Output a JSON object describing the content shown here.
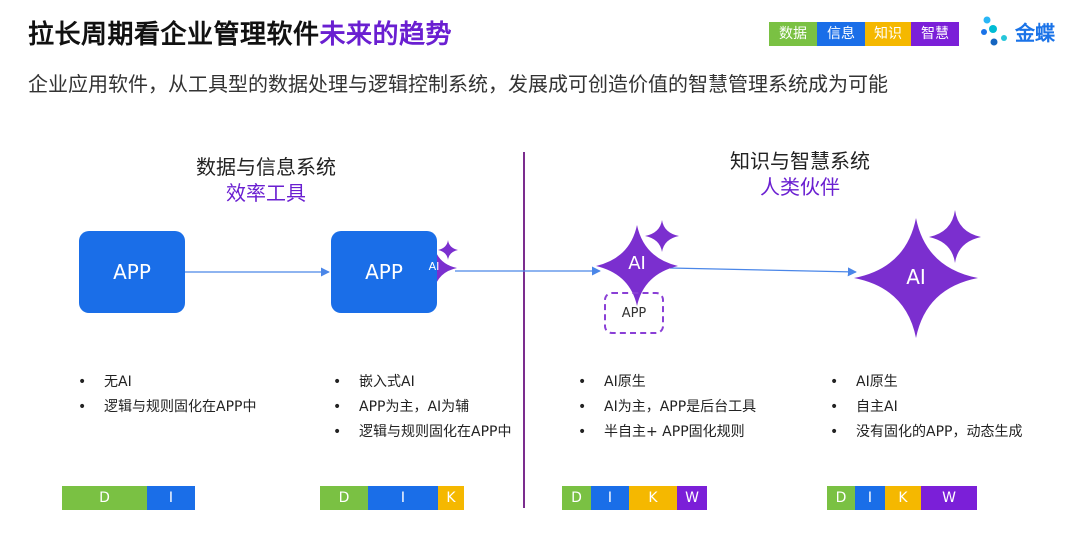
{
  "header": {
    "title_main": "拉长周期看企业管理软件",
    "title_highlight": "未来的趋势",
    "subtitle": "企业应用软件，从工具型的数据处理与逻辑控制系统，发展成可创造价值的智慧管理系统成为可能"
  },
  "legend": [
    {
      "label": "数据",
      "color": "#7ac143"
    },
    {
      "label": "信息",
      "color": "#1a6ee8"
    },
    {
      "label": "知识",
      "color": "#f5b800"
    },
    {
      "label": "智慧",
      "color": "#7b1fd8"
    }
  ],
  "logo": {
    "text": "金蝶"
  },
  "sections": {
    "left": {
      "heading": "数据与信息系统",
      "subheading": "效率工具"
    },
    "right": {
      "heading": "知识与智慧系统",
      "subheading": "人类伙伴"
    }
  },
  "stages": [
    {
      "node_label": "APP",
      "bullets": [
        "无AI",
        "逻辑与规则固化在APP中"
      ],
      "dikw": [
        "D",
        "I"
      ]
    },
    {
      "node_label": "APP",
      "badge_label": "AI",
      "bullets": [
        "嵌入式AI",
        "APP为主，AI为辅",
        "逻辑与规则固化在APP中"
      ],
      "dikw": [
        "D",
        "I",
        "K"
      ]
    },
    {
      "node_label": "AI",
      "sub_node_label": "APP",
      "bullets": [
        "AI原生",
        "AI为主，APP是后台工具",
        "半自主+ APP固化规则"
      ],
      "dikw": [
        "D",
        "I",
        "K",
        "W"
      ]
    },
    {
      "node_label": "AI",
      "bullets": [
        "AI原生",
        "自主AI",
        "没有固化的APP，动态生成"
      ],
      "dikw": [
        "D",
        "I",
        "K",
        "W"
      ]
    }
  ],
  "colors": {
    "app_blue": "#1a6ee8",
    "ai_purple": "#7b2fcf",
    "accent_purple": "#6a1fd1",
    "arrow_blue": "#4a86e8"
  }
}
